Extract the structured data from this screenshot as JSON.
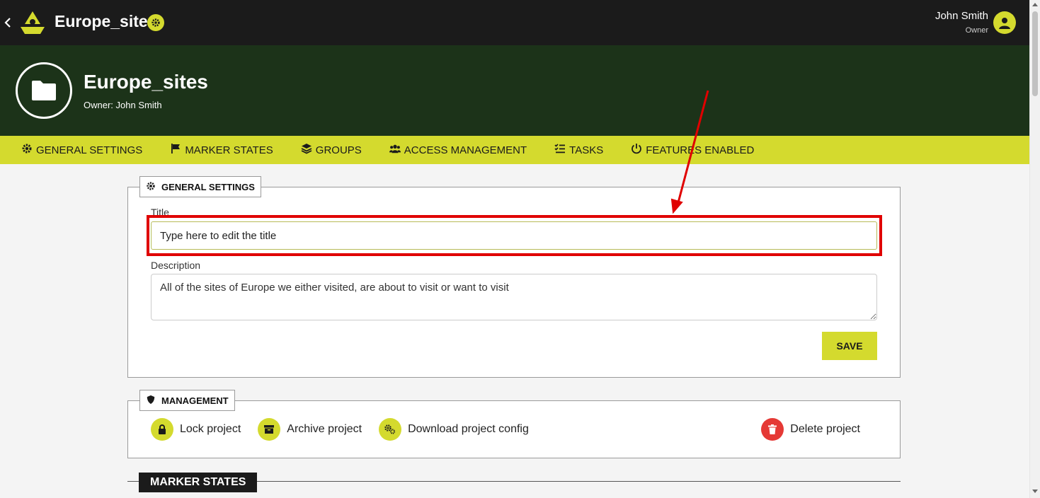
{
  "topbar": {
    "app_title": "Europe_sites",
    "user_name": "John Smith",
    "user_role": "Owner",
    "icons": [
      "back-chevron-icon",
      "app-logo-icon",
      "gear-icon",
      "user-avatar-icon"
    ]
  },
  "project": {
    "title": "Europe_sites",
    "owner_text": "Owner: John Smith"
  },
  "tabs": [
    {
      "label": "GENERAL SETTINGS",
      "icon": "gear-icon"
    },
    {
      "label": "MARKER STATES",
      "icon": "flag-icon"
    },
    {
      "label": "GROUPS",
      "icon": "layers-icon"
    },
    {
      "label": "ACCESS MANAGEMENT",
      "icon": "users-icon"
    },
    {
      "label": "TASKS",
      "icon": "checklist-icon"
    },
    {
      "label": "FEATURES ENABLED",
      "icon": "power-icon"
    }
  ],
  "general_settings": {
    "legend": "GENERAL SETTINGS",
    "title_label": "Title",
    "title_value": "Type here to edit the title",
    "description_label": "Description",
    "description_value": "All of the sites of Europe we either visited, are about to visit or want to visit",
    "save_label": "SAVE"
  },
  "management": {
    "legend": "MANAGEMENT",
    "actions": [
      {
        "label": "Lock project",
        "icon": "lock-icon"
      },
      {
        "label": "Archive project",
        "icon": "archive-icon"
      },
      {
        "label": "Download project config",
        "icon": "gears-icon"
      }
    ],
    "delete_label": "Delete project",
    "delete_icon": "trash-icon"
  },
  "marker_states": {
    "heading": "MARKER STATES"
  },
  "colors": {
    "accent": "#d4da2e",
    "dark": "#1b1b1b",
    "header_green": "#1c3319",
    "danger": "#e53935",
    "annotation_red": "#e00000"
  }
}
